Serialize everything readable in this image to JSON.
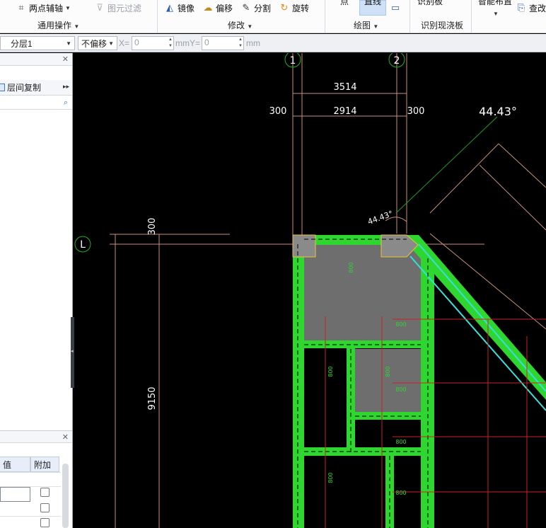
{
  "ribbon": {
    "two_point_axis": "两点辅轴",
    "element_filter": "图元过滤",
    "group_general": "通用操作",
    "mirror": "镜像",
    "offset": "偏移",
    "split": "分割",
    "rotate": "旋转",
    "group_modify": "修改",
    "point": "点",
    "line": "直线",
    "group_draw": "绘图",
    "identify_slab": "识别板",
    "group_identify": "识别现浇板",
    "smart_layout": "智能布置",
    "check_modify": "查改"
  },
  "toolbar": {
    "layer_select": "分层1",
    "offset_select": "不偏移",
    "x_label": "X=",
    "x_value": "0",
    "mm_y_label": "mmY=",
    "y_value": "0",
    "mm_label": "mm"
  },
  "left_panel": {
    "layer_copy": "层间复制",
    "prop_value_header": "值",
    "prop_extra_header": "附加"
  },
  "canvas": {
    "axis_1": "1",
    "axis_2": "2",
    "axis_L": "L",
    "dim_3514": "3514",
    "dim_2914": "2914",
    "dim_300_left": "300",
    "dim_300_right": "300",
    "angle_big": "44.43°",
    "angle_small": "44.43°",
    "dim_300_vertical": "300",
    "dim_9150": "9150",
    "rebar_800": "800"
  },
  "colors": {
    "beam_green": "#2fd62f",
    "slab_gray": "#6e6e6e",
    "column_gray": "#8a8a8a",
    "dim_brown": "#c8917a",
    "rebar_red": "#cc2222",
    "cyan_edge": "#38e0d8",
    "axis_circle": "#1bb31b"
  }
}
